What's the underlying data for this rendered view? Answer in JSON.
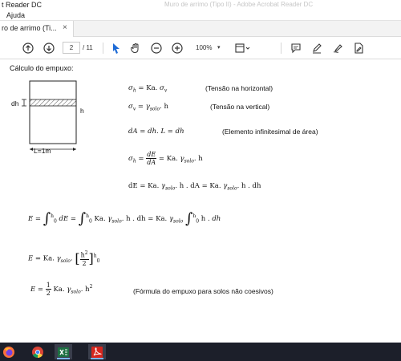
{
  "window": {
    "app_title": "t Reader DC",
    "doc_title": "Muro de arrimo (Tipo II) - Adobe Acrobat Reader DC"
  },
  "menu": {
    "items": [
      "Ajuda"
    ]
  },
  "tab": {
    "label": "ro de arrimo (Ti...",
    "close": "×"
  },
  "toolbar": {
    "page_current": "2",
    "page_total": "/ 11",
    "zoom": "100%",
    "zoom_caret": "▾"
  },
  "document": {
    "heading": "Cálculo do empuxo:",
    "figure": {
      "dh_label": "dh",
      "h_label": "h",
      "width_label": "L=1m"
    },
    "equations": [
      {
        "note": "(Tensão na horizontal)"
      },
      {
        "note": "(Tensão na vertical)"
      },
      {
        "note": "(Elemento infinitesimal de área)"
      },
      {
        "note": ""
      },
      {
        "note": ""
      }
    ],
    "final_note": "(Fórmula do empuxo para solos não coesivos)"
  },
  "taskbar": {
    "apps": [
      "firefox-icon",
      "chrome-icon",
      "excel-icon",
      "acrobat-icon"
    ]
  }
}
